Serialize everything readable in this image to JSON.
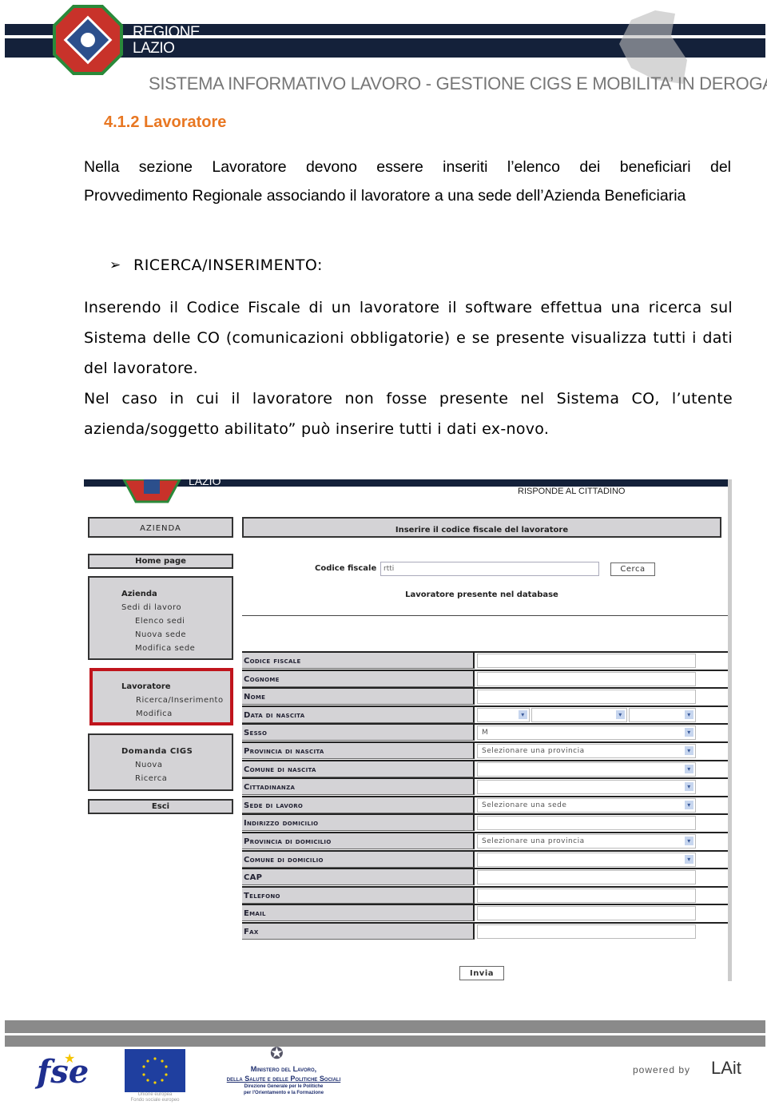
{
  "header": {
    "logo_text_1": "REGIONE",
    "logo_text_2": "LAZIO",
    "subtitle": "SISTEMA INFORMATIVO LAVORO - GESTIONE CIGS E MOBILITA’ IN DEROGA"
  },
  "section": {
    "number_title": "4.1.2  Lavoratore",
    "intro_line1": "Nella sezione Lavoratore devono essere inseriti l’elenco dei beneficiari del",
    "intro_line2": "Provvedimento Regionale associando il lavoratore a una sede dell’Azienda Beneficiaria",
    "bullet_label": "RICERCA/INSERIMENTO:",
    "para1": "Inserendo il Codice Fiscale di un lavoratore il software effettua una ricerca sul Sistema delle CO (comunicazioni obbligatorie) e se presente visualizza tutti i dati del lavoratore.",
    "para2": "Nel caso in cui il lavoratore non fosse presente nel Sistema CO, l’utente azienda/soggetto abilitato” può inserire tutti i dati ex-novo."
  },
  "screenshot": {
    "banner_text": "LAZIO",
    "banner_tagline": "RISPONDE AL CITTADINO",
    "sidebar": {
      "azienda_header": "AZIENDA",
      "home": "Home page",
      "azienda_group": {
        "title": "Azienda",
        "sub": "Sedi di lavoro",
        "items": [
          "Elenco sedi",
          "Nuova sede",
          "Modifica sede"
        ]
      },
      "lavoratore_group": {
        "title": "Lavoratore",
        "items": [
          "Ricerca/Inserimento",
          "Modifica"
        ]
      },
      "domanda_group": {
        "title": "Domanda CIGS",
        "items": [
          "Nuova",
          "Ricerca"
        ]
      },
      "esci": "Esci"
    },
    "main": {
      "title": "Inserire il codice fiscale del lavoratore",
      "cf_label": "Codice fiscale",
      "cf_value": "rtti",
      "search_button": "Cerca",
      "status": "Lavoratore presente nel database",
      "submit_button": "Invia"
    },
    "fields": [
      {
        "label": "Codice fiscale",
        "value": "",
        "type": "text"
      },
      {
        "label": "Cognome",
        "value": "",
        "type": "text"
      },
      {
        "label": "Nome",
        "value": "",
        "type": "text"
      },
      {
        "label": "Data di nascita",
        "value": "",
        "type": "date"
      },
      {
        "label": "Sesso",
        "value": "M",
        "type": "select"
      },
      {
        "label": "Provincia di nascita",
        "value": "Selezionare una provincia",
        "type": "select"
      },
      {
        "label": "Comune di nascita",
        "value": "",
        "type": "select"
      },
      {
        "label": "Cittadinanza",
        "value": "",
        "type": "select"
      },
      {
        "label": "Sede di lavoro",
        "value": "Selezionare una sede",
        "type": "select"
      },
      {
        "label": "Indirizzo domicilio",
        "value": "",
        "type": "text"
      },
      {
        "label": "Provincia di domicilio",
        "value": "Selezionare una provincia",
        "type": "select"
      },
      {
        "label": "Comune di domicilio",
        "value": "",
        "type": "select"
      },
      {
        "label": "CAP",
        "value": "",
        "type": "text"
      },
      {
        "label": "Telefono",
        "value": "",
        "type": "text"
      },
      {
        "label": "Email",
        "value": "",
        "type": "text"
      },
      {
        "label": "Fax",
        "value": "",
        "type": "text"
      }
    ]
  },
  "footer": {
    "fse": "fse",
    "eu_caption_1": "Unione europea",
    "eu_caption_2": "Fondo sociale europeo",
    "ministry_1": "Ministero del Lavoro,",
    "ministry_2": "della Salute e delle Politiche Sociali",
    "ministry_3": "Direzione Generale per le Politiche",
    "ministry_4": "per l'Orientamento e la Formazione",
    "powered_by": "powered by",
    "lait": "LAit"
  },
  "colors": {
    "heading": "#e87722",
    "navy": "#14213a",
    "highlight": "#c0141c"
  }
}
